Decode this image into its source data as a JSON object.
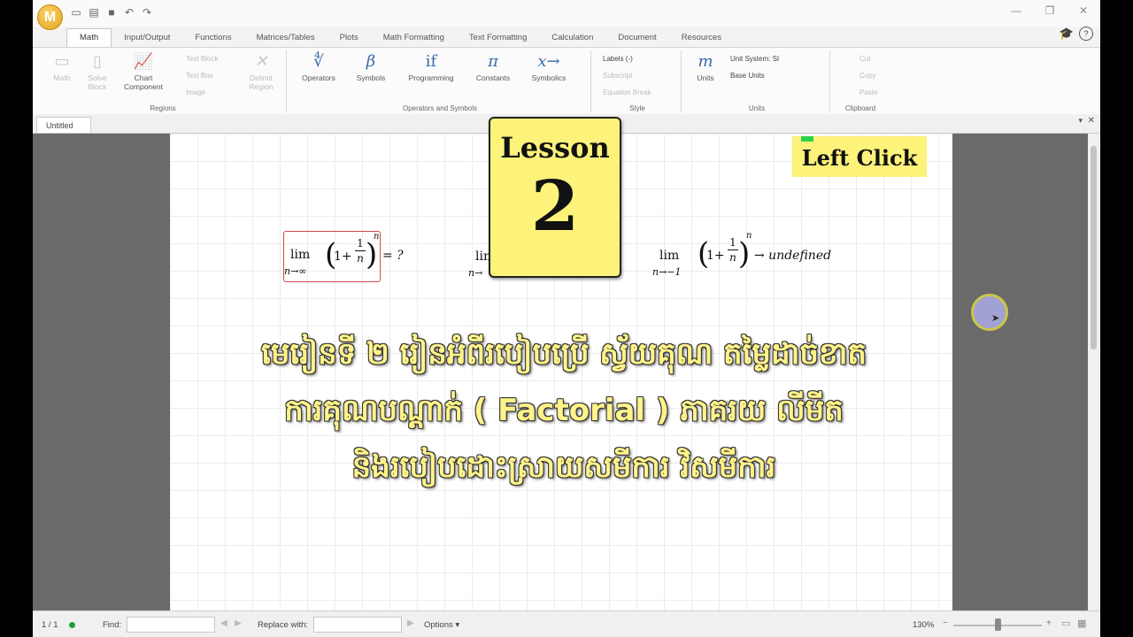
{
  "app": {
    "logo_letter": "M"
  },
  "tabs": [
    "Math",
    "Input/Output",
    "Functions",
    "Matrices/Tables",
    "Plots",
    "Math Formatting",
    "Text Formatting",
    "Calculation",
    "Document",
    "Resources"
  ],
  "ribbon": {
    "regions": {
      "label": "Regions",
      "math": "Math",
      "solve_block": "Solve Block",
      "chart_component": "Chart Component",
      "text_block": "Text Block",
      "text_box": "Text Box",
      "image": "Image",
      "delimit_region": "Delimit Region"
    },
    "operators_symbols": {
      "label": "Operators and Symbols",
      "operators": "Operators",
      "symbols": "Symbols",
      "programming": "Programming",
      "constants": "Constants",
      "symbolics": "Symbolics"
    },
    "style": {
      "label": "Style",
      "labels": "Labels (-)",
      "subscript": "Subscript",
      "equation_break": "Equation Break"
    },
    "units": {
      "label": "Units",
      "units": "Units",
      "unit_system": "Unit System: SI",
      "base_units": "Base Units"
    },
    "clipboard": {
      "label": "Clipboard",
      "cut": "Cut",
      "copy": "Copy",
      "paste": "Paste"
    }
  },
  "document": {
    "tab_title": "Untitled"
  },
  "math": {
    "lim": "lim",
    "eq1": {
      "sub": "n→∞",
      "num": "1",
      "den": "n",
      "exp": "n",
      "rhs": "= ?"
    },
    "eq2": {
      "sub": "n→"
    },
    "eq3": {
      "sub": "n→−1",
      "num": "1",
      "den": "n",
      "exp": "n",
      "rhs": "→ undefined"
    }
  },
  "overlay": {
    "lesson_word": "Lesson",
    "lesson_number": "2",
    "left_click": "Left Click",
    "khmer_lines": [
      "មេរៀនទី ២ រៀនអំពីរបៀបប្រើ ស្វ័យគុណ តម្លៃដាច់ខាត",
      "ការគុណបណ្តាក់ ( Factorial ) ភាគរយ លីមីត",
      "និងរបៀបដោះស្រាយសមីការ វិសមីការ"
    ]
  },
  "status": {
    "page": "1 / 1",
    "find_label": "Find:",
    "replace_label": "Replace with:",
    "options": "Options",
    "zoom": "130%"
  }
}
